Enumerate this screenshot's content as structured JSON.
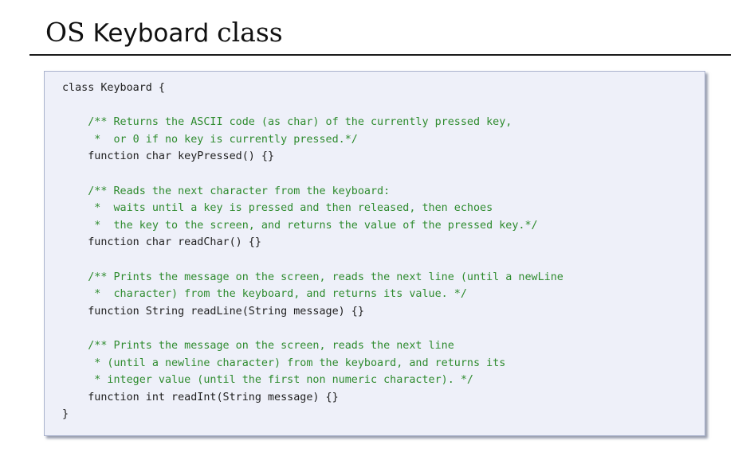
{
  "slide": {
    "title_part1": "OS",
    "title_part2": "Keyboard",
    "title_part3": "class"
  },
  "code": {
    "lines": [
      {
        "text": "class Keyboard {",
        "kind": "code"
      },
      {
        "text": "",
        "kind": "blank"
      },
      {
        "text": "    /** Returns the ASCII code (as char) of the currently pressed key,",
        "kind": "comment"
      },
      {
        "text": "     *  or 0 if no key is currently pressed.*/",
        "kind": "comment"
      },
      {
        "text": "    function char keyPressed() {}",
        "kind": "code"
      },
      {
        "text": "",
        "kind": "blank"
      },
      {
        "text": "    /** Reads the next character from the keyboard:",
        "kind": "comment"
      },
      {
        "text": "     *  waits until a key is pressed and then released, then echoes",
        "kind": "comment"
      },
      {
        "text": "     *  the key to the screen, and returns the value of the pressed key.*/",
        "kind": "comment"
      },
      {
        "text": "    function char readChar() {}",
        "kind": "code"
      },
      {
        "text": "",
        "kind": "blank"
      },
      {
        "text": "    /** Prints the message on the screen, reads the next line (until a newLine",
        "kind": "comment"
      },
      {
        "text": "     *  character) from the keyboard, and returns its value. */",
        "kind": "comment"
      },
      {
        "text": "    function String readLine(String message) {}",
        "kind": "code"
      },
      {
        "text": "",
        "kind": "blank"
      },
      {
        "text": "    /** Prints the message on the screen, reads the next line",
        "kind": "comment"
      },
      {
        "text": "     * (until a newline character) from the keyboard, and returns its",
        "kind": "comment"
      },
      {
        "text": "     * integer value (until the first non numeric character). */",
        "kind": "comment"
      },
      {
        "text": "    function int readInt(String message) {}",
        "kind": "code"
      },
      {
        "text": "}",
        "kind": "code"
      }
    ],
    "colors": {
      "code_text": "#1e1e1e",
      "comment_text": "#2e8b2e",
      "box_background": "#eef0f9",
      "box_border": "#a9b2cc"
    }
  }
}
